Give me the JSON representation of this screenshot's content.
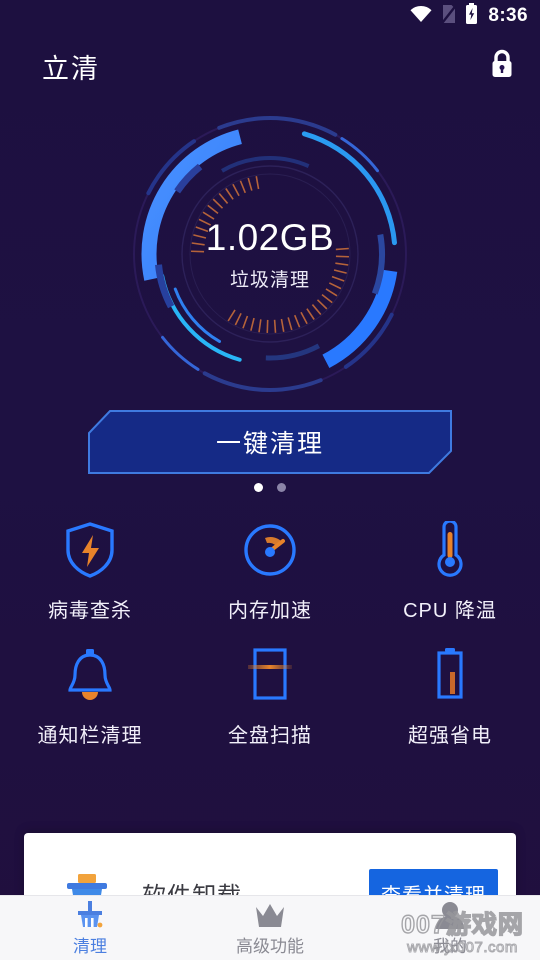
{
  "colors": {
    "bg_top": "#1d1040",
    "bg_bottom": "#200f3e",
    "accent_blue": "#2979ff",
    "accent_cyan": "#29b6f6",
    "accent_orange": "#e8832a",
    "button_fill": "#152a86",
    "button_border": "#3f7ae0",
    "card_button": "#1565e0",
    "nav_active": "#4b7fe0",
    "nav_inactive": "#8a8a93"
  },
  "statusbar": {
    "time": "8:36",
    "icons": [
      "wifi-icon",
      "sim-card-off-icon",
      "battery-charging-icon"
    ]
  },
  "titlebar": {
    "app_title": "立清",
    "lock_icon": "lock-icon"
  },
  "gauge": {
    "value": "1.02GB",
    "caption": "垃圾清理",
    "arc_color_primary": "#2979ff",
    "arc_color_secondary": "#29b6f6",
    "tick_color": "#b5633a"
  },
  "primary_button": {
    "label": "一键清理"
  },
  "carousel": {
    "dots": 2,
    "active_index": 0
  },
  "grid": {
    "items": [
      {
        "label": "病毒查杀",
        "icon": "shield-virus-icon"
      },
      {
        "label": "内存加速",
        "icon": "speedometer-icon"
      },
      {
        "label": "CPU 降温",
        "icon": "thermometer-icon"
      },
      {
        "label": "通知栏清理",
        "icon": "bell-icon"
      },
      {
        "label": "全盘扫描",
        "icon": "scan-rectangle-icon"
      },
      {
        "label": "超强省电",
        "icon": "battery-icon"
      }
    ]
  },
  "card": {
    "icon": "trash-bin-icon",
    "title": "软件卸载",
    "button_label": "查看并清理"
  },
  "bottomnav": {
    "items": [
      {
        "label": "清理",
        "icon": "broom-icon",
        "active": true
      },
      {
        "label": "高级功能",
        "icon": "crown-icon",
        "active": false
      },
      {
        "label": "我的",
        "icon": "person-icon",
        "active": false
      }
    ]
  },
  "watermark": {
    "main": "007游戏网",
    "sub": "www.jx007.com"
  }
}
